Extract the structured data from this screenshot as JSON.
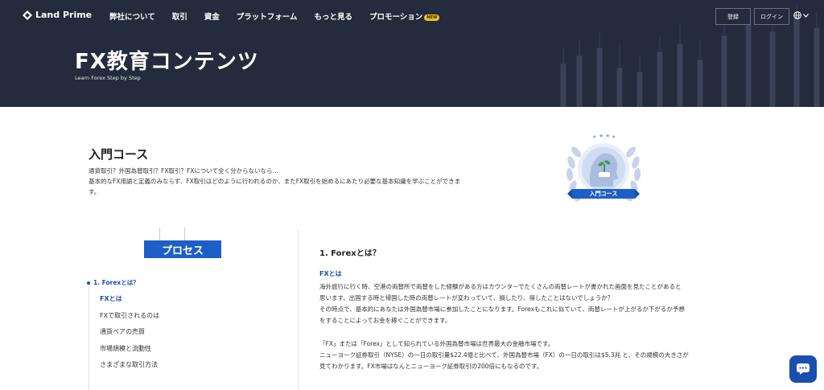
{
  "brand": {
    "name": "Land Prime"
  },
  "nav": {
    "links": [
      "弊社について",
      "取引",
      "資金",
      "プラットフォーム",
      "もっと見る",
      "プロモーション"
    ],
    "new_badge": "NEW",
    "open_label": "登録",
    "login_label": "ログイン"
  },
  "hero": {
    "title": "FX教育コンテンツ",
    "subtitle": "Learn Forex Step by Step"
  },
  "course": {
    "title": "入門コース",
    "desc_line1": "通貨取引？外国為替取引？FX取引？FXについて全く分からないなら…",
    "desc_line2": "基本的なFX用語と定義のみならず、FX取引はどのように行われるのか、またFX取引を始めるにあたり必要な基本知識を学ぶことができま",
    "desc_line3": "す。",
    "badge_label": "入門コース"
  },
  "sidebar": {
    "process_label": "プロセス",
    "toc_head": "1. Forexとは？",
    "items": [
      "FXとは",
      "FXで取引されるのは",
      "通貨ペアの売買",
      "市場規模と流動性",
      "さまざまな取引方法"
    ]
  },
  "content": {
    "section_title": "1. Forexとは？",
    "sub_title": "FXとは",
    "p1": "海外旅行に行く時、空港の両替所で両替をした経験がある方はカウンターでたくさんの両替レートが書かれた画面を見たことがあると",
    "p2": "思います。出国する時と帰国した時の両替レートが変わっていて、損したり、得したことはないでしょうか？",
    "p3": "その時点で、基本的にあなたは外国為替市場に参加したことになります。Forexもこれに似ていて、両替レートが上がるか下がるか予想",
    "p4": "をすることによってお金を稼ぐことができます。",
    "p5": "「FX」または「Forex」として知られている外国為替市場は世界最大の金融市場です。",
    "p6": "ニューヨーク証券取引（NYSE）の一日の取引量$22.4億と比べて、外国為替市場（FX）の一日の取引は$5.3兆 と、その規模の大きさが",
    "p7": "見てわかります。FX市場はなんとニューヨーク証券取引の200倍にもなるのです。"
  },
  "colors": {
    "hero_bg": "#232b3d",
    "accent": "#1e5fc6",
    "link": "#1a4fb0"
  }
}
